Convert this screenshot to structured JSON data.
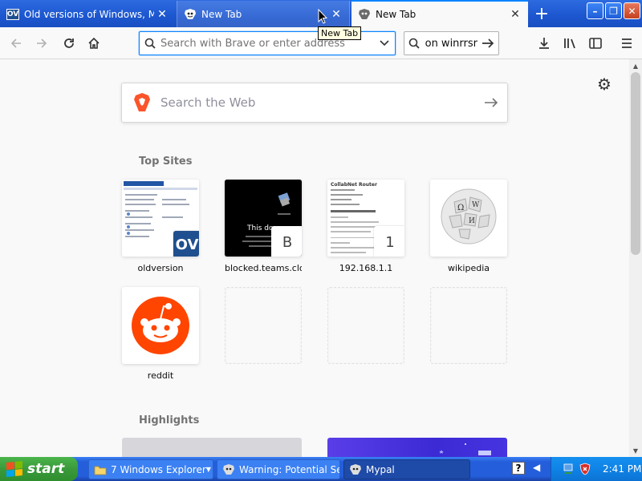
{
  "tabs": [
    {
      "title": "Old versions of Windows, Mac and Linux",
      "favicon": "ov-favicon-icon",
      "favicon_text": "OV"
    },
    {
      "title": "New Tab",
      "favicon": "brave-favicon-icon"
    },
    {
      "title": "New Tab",
      "favicon": "brave-favicon-icon",
      "active": true
    }
  ],
  "tooltip": "New Tab",
  "navbar": {
    "url_placeholder": "Search with Brave or enter address",
    "search_value": "on winrrsr"
  },
  "content": {
    "websearch_placeholder": "Search the Web",
    "top_sites_title": "Top Sites",
    "highlights_title": "Highlights",
    "top_sites": [
      {
        "label": "oldversion",
        "thumb": "oldversion-thumbnail",
        "badge": "OV"
      },
      {
        "label": "blocked.teams.clo...",
        "thumb": "blocked-page-thumbnail",
        "letter": "B",
        "thumb_text": "This do"
      },
      {
        "label": "192.168.1.1",
        "thumb": "router-page-thumbnail",
        "letter": "1",
        "thumb_text": "CollabNet Router"
      },
      {
        "label": "wikipedia",
        "thumb": "wikipedia-logo"
      },
      {
        "label": "reddit",
        "thumb": "reddit-logo"
      },
      {
        "label": ""
      },
      {
        "label": ""
      },
      {
        "label": ""
      }
    ]
  },
  "taskbar": {
    "start_label": "start",
    "buttons": [
      {
        "label": "7 Windows Explorer",
        "icon": "folder-icon"
      },
      {
        "label": "Warning: Potential Se...",
        "icon": "brave-icon"
      },
      {
        "label": "Mypal",
        "icon": "mypal-icon",
        "active": true
      }
    ],
    "time": "2:41 PM"
  },
  "colors": {
    "xp_blue": "#245edb",
    "accent": "#0a84ff",
    "reddit": "#ff4500"
  }
}
